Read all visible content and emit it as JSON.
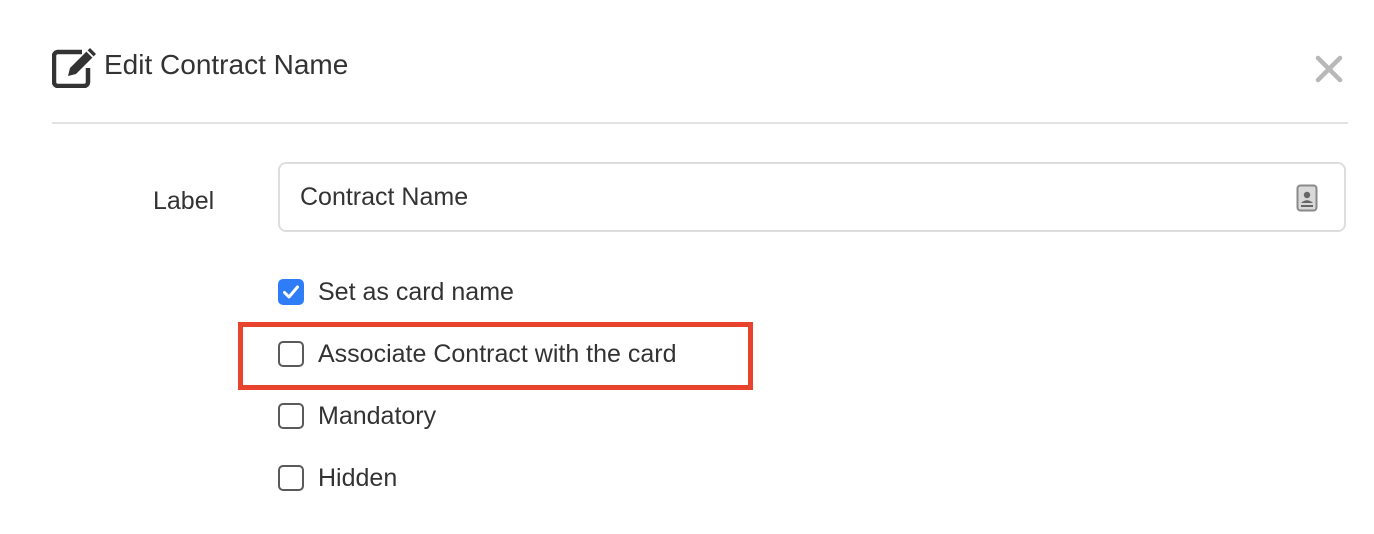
{
  "dialog": {
    "title": "Edit Contract Name",
    "title_icon": "edit-icon",
    "close_icon": "close-icon"
  },
  "form": {
    "label_caption": "Label",
    "label_value": "Contract Name",
    "label_field_icon": "contact-card-icon"
  },
  "options": [
    {
      "label": "Set as card name",
      "checked": true
    },
    {
      "label": "Associate Contract with the card",
      "checked": false
    },
    {
      "label": "Mandatory",
      "checked": false
    },
    {
      "label": "Hidden",
      "checked": false
    }
  ],
  "colors": {
    "checkbox_checked": "#2f7df6",
    "highlight": "#e8432d",
    "divider": "#e2e2e2"
  }
}
